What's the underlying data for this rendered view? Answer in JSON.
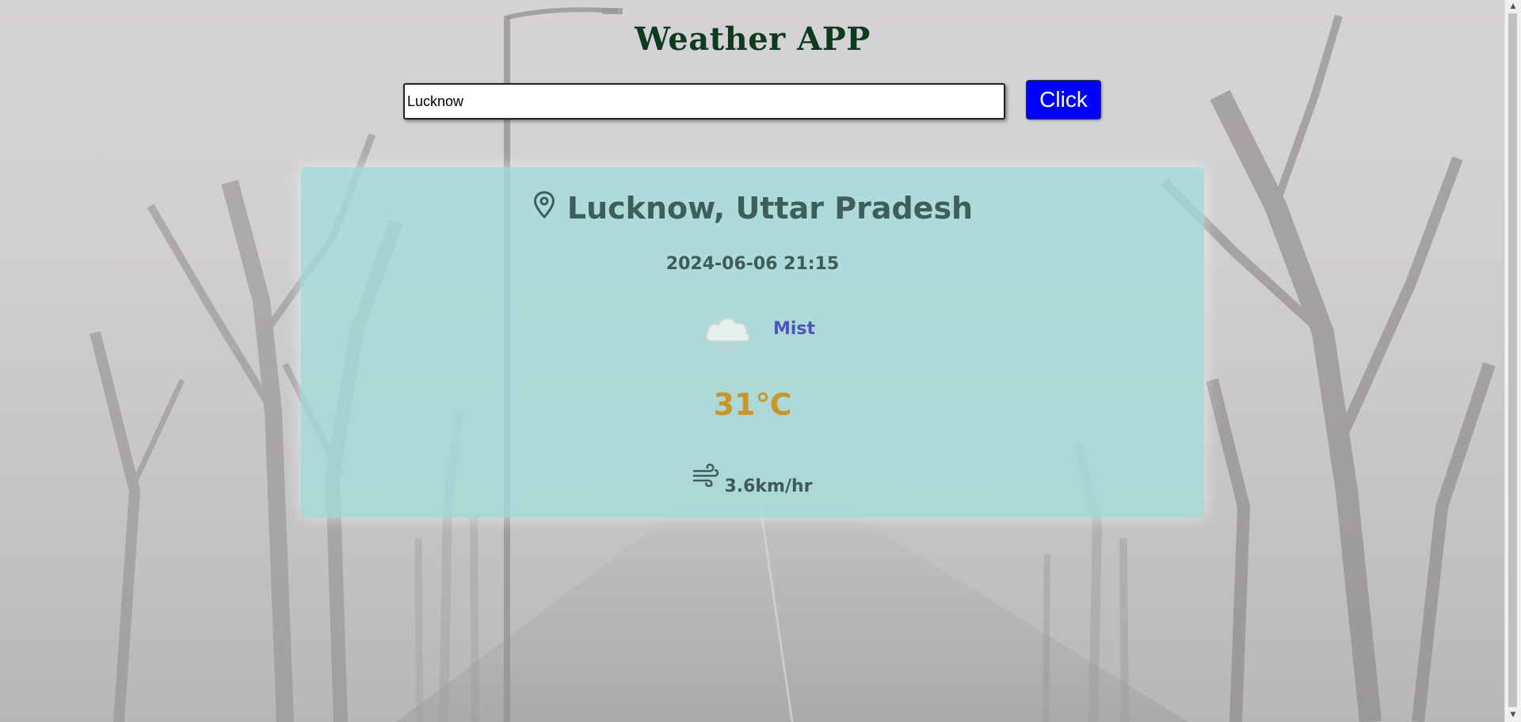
{
  "app": {
    "title": "Weather APP"
  },
  "search": {
    "value": "Lucknow",
    "button_label": "Click"
  },
  "weather": {
    "location": "Lucknow, Uttar Pradesh",
    "datetime": "2024-06-06 21:15",
    "condition": "Mist",
    "condition_icon": "cloud-icon",
    "temperature": "31℃",
    "wind_icon": "wind-icon",
    "wind": "3.6km/hr"
  },
  "colors": {
    "title": "#0e3b1e",
    "button_bg": "#0000ff",
    "card_bg": "#a4dedb",
    "location_text": "#3d5e5c",
    "condition_text": "#4f55b8",
    "temperature_text": "#c9962e"
  }
}
